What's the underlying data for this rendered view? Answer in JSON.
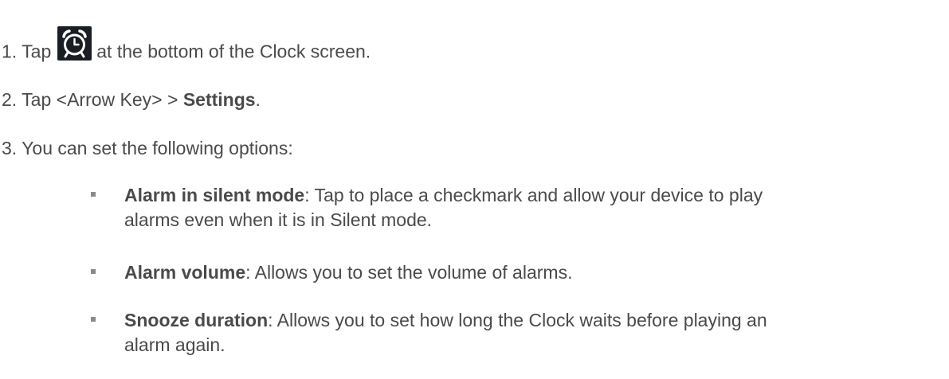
{
  "steps": [
    {
      "number": "1.",
      "prefix": "Tap",
      "icon": "alarm-clock-icon",
      "suffix": "at the bottom of the Clock screen."
    },
    {
      "number": "2.",
      "text": "Tap <Arrow Key> > ",
      "bold": "Settings",
      "end": "."
    },
    {
      "number": "3.",
      "text": "You can set the following options:"
    }
  ],
  "options": [
    {
      "term": "Alarm in silent mode",
      "description": ": Tap to place a checkmark and allow your device to play",
      "description_line2": "alarms even when it is in Silent mode."
    },
    {
      "term": "Alarm volume",
      "description": ": Allows you to set the volume of alarms."
    },
    {
      "term": "Snooze duration",
      "description": ": Allows you to set how long the Clock waits before playing an",
      "description_line2": "alarm again."
    }
  ],
  "colors": {
    "text": "#4a4a4a",
    "icon_background": "#1a1e24",
    "icon_foreground": "#ffffff",
    "bullet": "#8a8a8a"
  }
}
